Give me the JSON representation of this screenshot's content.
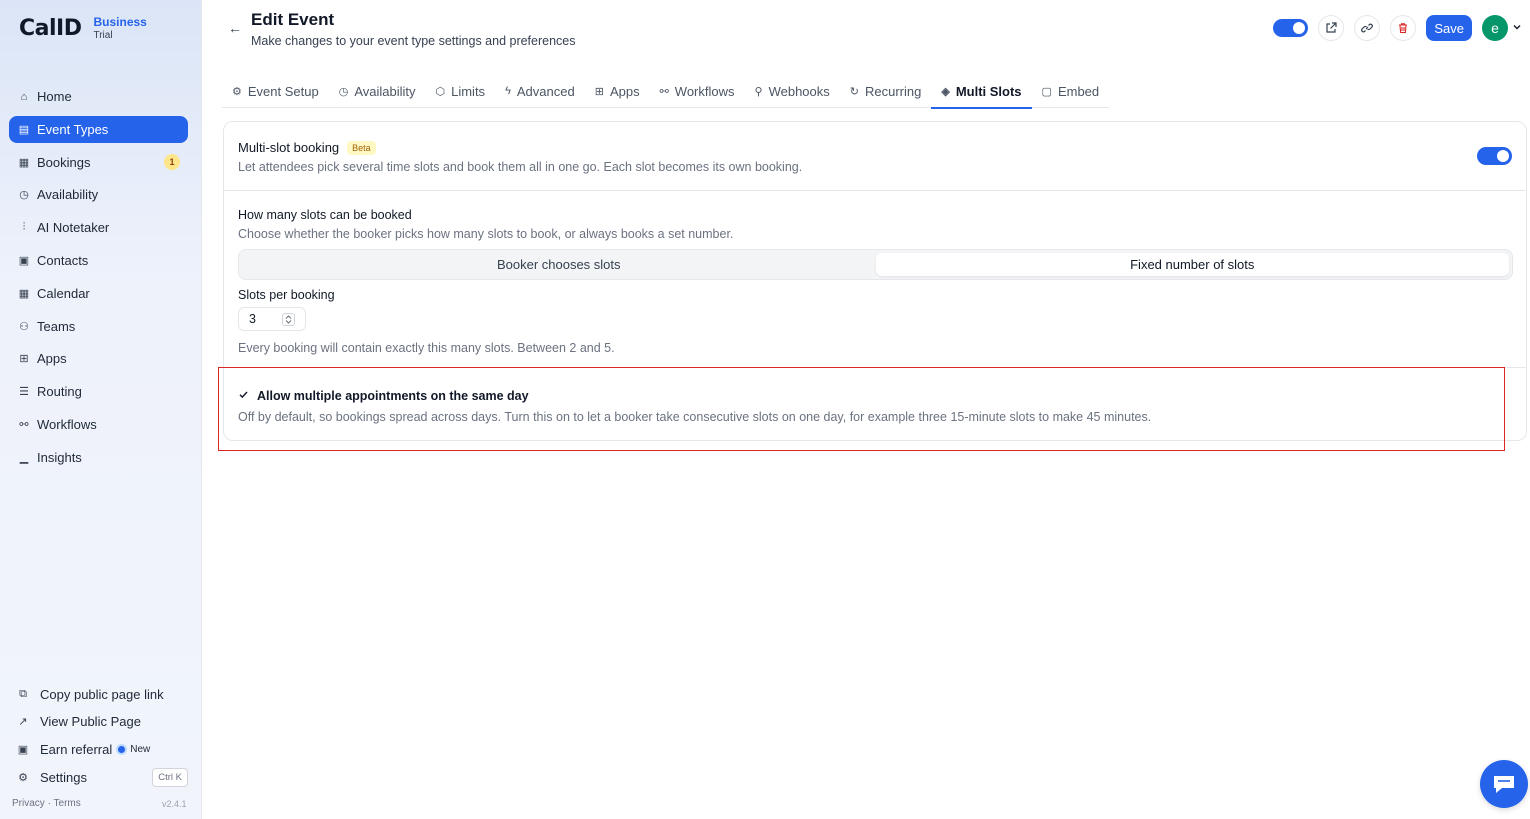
{
  "brand": {
    "logo": "CalID",
    "plan": "Business",
    "plan_sub": "Trial"
  },
  "sidebar": {
    "items": [
      {
        "label": "Home",
        "icon": "home-icon",
        "glyph": "⌂"
      },
      {
        "label": "Event Types",
        "icon": "link-icon",
        "glyph": "▤",
        "active": true
      },
      {
        "label": "Bookings",
        "icon": "calendar-icon",
        "glyph": "▦",
        "badge": "1"
      },
      {
        "label": "Availability",
        "icon": "clock-icon",
        "glyph": "◷"
      },
      {
        "label": "AI Notetaker",
        "icon": "waveform-icon",
        "glyph": "⫶"
      },
      {
        "label": "Contacts",
        "icon": "contact-icon",
        "glyph": "▣"
      },
      {
        "label": "Calendar",
        "icon": "calendar-icon",
        "glyph": "▦"
      },
      {
        "label": "Teams",
        "icon": "users-icon",
        "glyph": "⚇"
      },
      {
        "label": "Apps",
        "icon": "grid-icon",
        "glyph": "⊞"
      },
      {
        "label": "Routing",
        "icon": "routing-icon",
        "glyph": "☰"
      },
      {
        "label": "Workflows",
        "icon": "workflow-icon",
        "glyph": "⚯"
      },
      {
        "label": "Insights",
        "icon": "chart-icon",
        "glyph": "▁"
      }
    ],
    "bottom": [
      {
        "label": "Copy public page link",
        "icon": "copy-icon",
        "glyph": "⧉"
      },
      {
        "label": "View Public Page",
        "icon": "external-link-icon",
        "glyph": "↗"
      },
      {
        "label": "Earn referral",
        "icon": "gift-icon",
        "glyph": "▣",
        "new_label": "New"
      },
      {
        "label": "Settings",
        "icon": "gear-icon",
        "glyph": "⚙",
        "shortcut": "Ctrl K"
      }
    ],
    "footer": {
      "privacy": "Privacy",
      "sep": " · ",
      "terms": "Terms",
      "version": "v2.4.1"
    }
  },
  "header": {
    "title": "Edit Event",
    "subtitle": "Make changes to your event type settings and preferences",
    "save_label": "Save",
    "avatar_initial": "e",
    "back_glyph": "←"
  },
  "tabs": [
    {
      "label": "Event Setup",
      "glyph": "⚙"
    },
    {
      "label": "Availability",
      "glyph": "◷"
    },
    {
      "label": "Limits",
      "glyph": "⬡"
    },
    {
      "label": "Advanced",
      "glyph": "ϟ"
    },
    {
      "label": "Apps",
      "glyph": "⊞"
    },
    {
      "label": "Workflows",
      "glyph": "⚯"
    },
    {
      "label": "Webhooks",
      "glyph": "⚲"
    },
    {
      "label": "Recurring",
      "glyph": "↻"
    },
    {
      "label": "Multi Slots",
      "glyph": "◈",
      "active": true
    },
    {
      "label": "Embed",
      "glyph": "▢"
    }
  ],
  "multislot": {
    "title": "Multi-slot booking",
    "beta": "Beta",
    "description": "Let attendees pick several time slots and book them all in one go. Each slot becomes its own booking.",
    "enabled": true,
    "how_many_title": "How many slots can be booked",
    "how_many_desc": "Choose whether the booker picks how many slots to book, or always books a set number.",
    "options": [
      "Booker chooses slots",
      "Fixed number of slots"
    ],
    "selected_option": "Fixed number of slots",
    "slots_label": "Slots per booking",
    "slots_value": "3",
    "slots_hint": "Every booking will contain exactly this many slots. Between 2 and 5.",
    "allow_label": "Allow multiple appointments on the same day",
    "allow_checked": true,
    "allow_desc": "Off by default, so bookings spread across days. Turn this on to let a booker take consecutive slots on one day, for example three 15-minute slots to make 45 minutes."
  },
  "colors": {
    "accent": "#2563eb",
    "danger": "#dc2626",
    "avatar": "#059669",
    "beta": "#fef9c3"
  }
}
